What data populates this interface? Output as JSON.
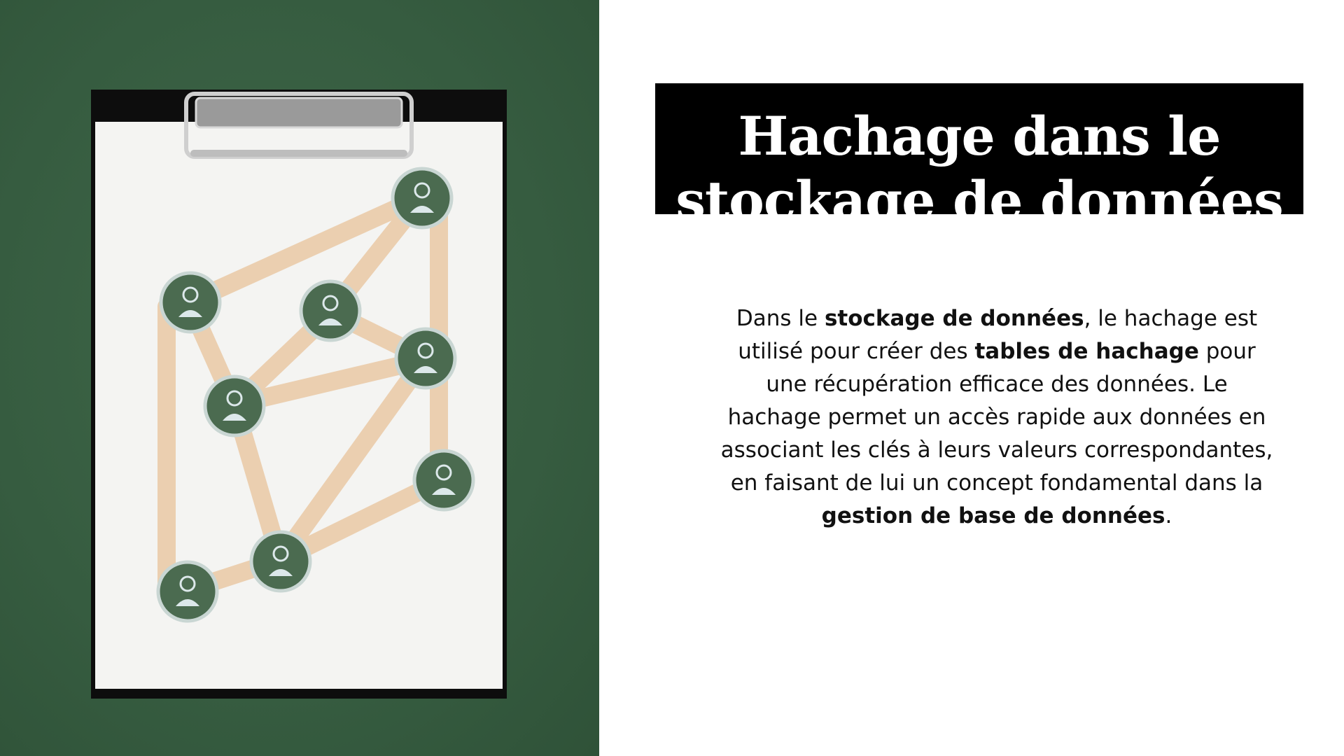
{
  "slide": {
    "title": "Hachage dans le stockage de données",
    "body_segments": [
      {
        "text": "Dans le ",
        "bold": false
      },
      {
        "text": "stockage de données",
        "bold": true
      },
      {
        "text": ", le hachage est utilisé pour créer des ",
        "bold": false
      },
      {
        "text": "tables de hachage",
        "bold": true
      },
      {
        "text": " pour une récupération efficace des données. Le hachage permet un accès rapide aux données en associant les clés à leurs valeurs correspondantes, en faisant de lui un concept fondamental dans la ",
        "bold": false
      },
      {
        "text": "gestion de base de données",
        "bold": true
      },
      {
        "text": ".",
        "bold": false
      }
    ]
  },
  "colors": {
    "background": "#ffffff",
    "image_background": "#365c40",
    "title_bar": "#000000",
    "title_text": "#ffffff",
    "body_text": "#111111",
    "sticks": "#ebcfb0",
    "node_fill": "#4b6b50"
  },
  "image": {
    "description_icon": "clipboard-network-photo"
  }
}
